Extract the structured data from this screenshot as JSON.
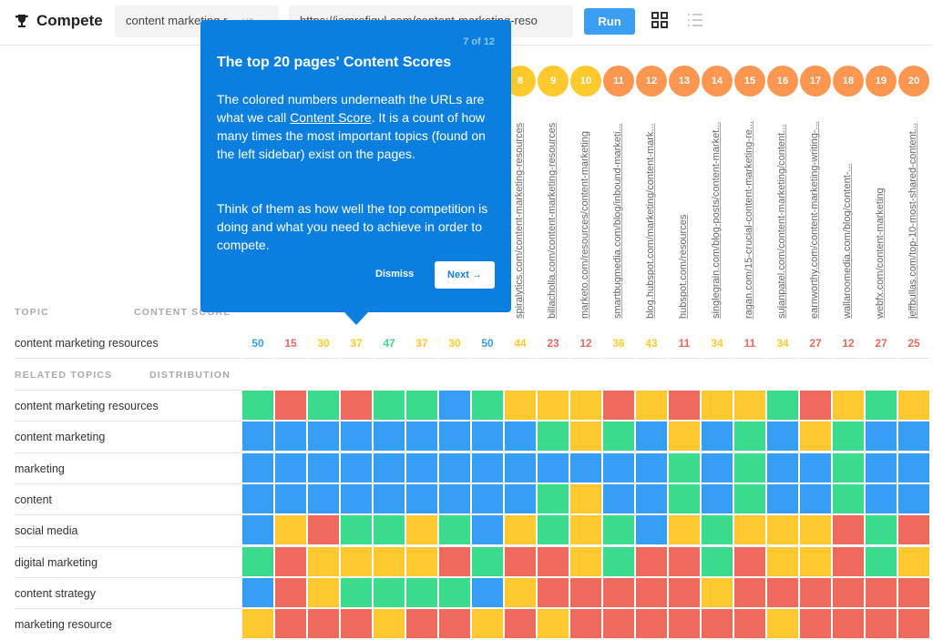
{
  "header": {
    "title": "Compete",
    "keyword_value": "content marketing r",
    "locale": "en-US",
    "url_value": "https://iamrofiqul.com/content-marketing-reso",
    "run_label": "Run",
    "icons": [
      "trophy-icon",
      "grid-view-icon",
      "list-view-icon"
    ]
  },
  "colors": {
    "G": "#3adb8a",
    "R": "#ee6a5c",
    "Y": "#fdc92f",
    "B": "#379ff3",
    "circle_yellow": "#fec92d",
    "circle_orange": "#fd9650",
    "accent": "#0b7fe0"
  },
  "rank_circles": [
    {
      "n": "8",
      "c": "circle_yellow"
    },
    {
      "n": "9",
      "c": "circle_yellow"
    },
    {
      "n": "10",
      "c": "circle_yellow"
    },
    {
      "n": "11",
      "c": "circle_orange"
    },
    {
      "n": "12",
      "c": "circle_orange"
    },
    {
      "n": "13",
      "c": "circle_orange"
    },
    {
      "n": "14",
      "c": "circle_orange"
    },
    {
      "n": "15",
      "c": "circle_orange"
    },
    {
      "n": "16",
      "c": "circle_orange"
    },
    {
      "n": "17",
      "c": "circle_orange"
    },
    {
      "n": "18",
      "c": "circle_orange"
    },
    {
      "n": "19",
      "c": "circle_orange"
    },
    {
      "n": "20",
      "c": "circle_orange"
    }
  ],
  "urls_visible": [
    "spiralytics.com/content-marketing-resources",
    "billacholla.com/content-marketing-resources",
    "marketo.com/resources/content-marketing",
    "smartbugmedia.com/blog/inbound-marketi...",
    "blog.hubspot.com/marketing/content-mark...",
    "hubspot.com/resources",
    "singlegrain.com/blog-posts/content-market...",
    "ragan.com/15-crucial-content-marketing-re...",
    "sujanpatel.com/content-marketing/content...",
    "earnworthy.com/content-marketing-writing-...",
    "wallaroomedia.com/blog/content-...",
    "webfx.com/content-marketing",
    "jeffbullas.com/top-10-most-shared-content..."
  ],
  "table": {
    "topic_header": "TOPIC",
    "score_header": "CONTENT SCORE",
    "topic": "content marketing resources",
    "scores": [
      {
        "v": "50",
        "c": "B"
      },
      {
        "v": "15",
        "c": "R"
      },
      {
        "v": "30",
        "c": "Y"
      },
      {
        "v": "37",
        "c": "Y"
      },
      {
        "v": "47",
        "c": "G"
      },
      {
        "v": "37",
        "c": "Y"
      },
      {
        "v": "30",
        "c": "Y"
      },
      {
        "v": "50",
        "c": "B"
      },
      {
        "v": "44",
        "c": "Y"
      },
      {
        "v": "23",
        "c": "R"
      },
      {
        "v": "12",
        "c": "R"
      },
      {
        "v": "36",
        "c": "Y"
      },
      {
        "v": "43",
        "c": "Y"
      },
      {
        "v": "11",
        "c": "R"
      },
      {
        "v": "34",
        "c": "Y"
      },
      {
        "v": "11",
        "c": "R"
      },
      {
        "v": "34",
        "c": "Y"
      },
      {
        "v": "27",
        "c": "R"
      },
      {
        "v": "12",
        "c": "R"
      },
      {
        "v": "27",
        "c": "R"
      },
      {
        "v": "25",
        "c": "R"
      }
    ],
    "related_header": "RELATED TOPICS",
    "distribution_header": "DISTRIBUTION",
    "related": [
      {
        "label": "content marketing resources",
        "cells": "GRGRGGBGYYYRYRYYGRYGY"
      },
      {
        "label": "content marketing",
        "cells": "BBBBBBBBBGYGBYBGBYGBB"
      },
      {
        "label": "marketing",
        "cells": "BBBBBBBBBBBBBGBGBBGBB"
      },
      {
        "label": "content",
        "cells": "BBBBBBBBBGYBBGBGBBGBB"
      },
      {
        "label": "social media",
        "cells": "BYRGGYGBYGYGBYGYYYRGR"
      },
      {
        "label": "digital marketing",
        "cells": "GRYYYYRGRRYGRRGRYYRGY"
      },
      {
        "label": "content strategy",
        "cells": "BRYGGGGBYRRRRRYRRRRRR"
      },
      {
        "label": "marketing resource",
        "cells": "YRRRYRRYRYRRRRRRYRRRR"
      }
    ]
  },
  "tooltip": {
    "step": "7 of 12",
    "title": "The top 20 pages' Content Scores",
    "p1_a": "The colored numbers underneath the URLs are what we call ",
    "p1_link": "Content Score",
    "p1_b": ".  It is a count of how many times the most important topics (found on the left sidebar) exist on the pages.",
    "p2": "Think of them as how well the top competition is doing and what you need to achieve in order to compete.",
    "dismiss": "Dismiss",
    "next": "Next →"
  }
}
